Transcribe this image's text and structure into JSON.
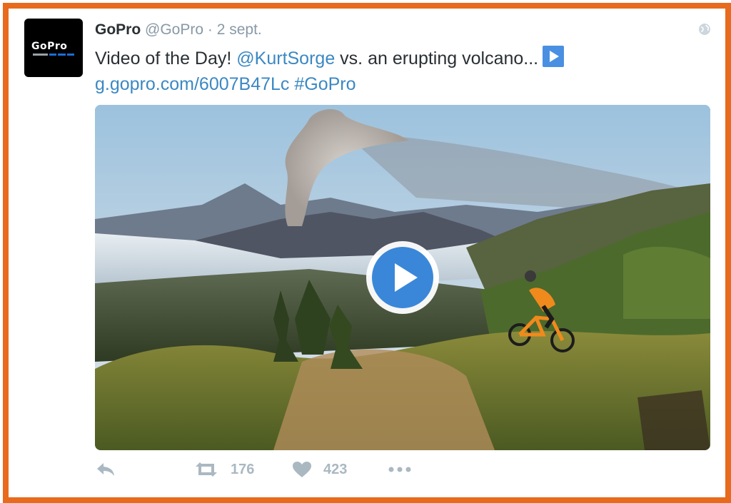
{
  "tweet": {
    "author_name": "GoPro",
    "handle": "@GoPro",
    "separator": " · ",
    "date": "2 sept.",
    "avatar_text": "GoPro",
    "text_prefix": "Video of the Day! ",
    "mention": "@KurtSorge",
    "text_middle": " vs. an erupting volcano...",
    "url": "g.gopro.com/6007B47Lc",
    "hashtag": "#GoPro"
  },
  "actions": {
    "retweets": "176",
    "likes": "423"
  },
  "colors": {
    "frame": "#e86a1c",
    "link": "#3b88c3",
    "play": "#3a87d9",
    "icon": "#aab8c2"
  },
  "icons": {
    "reply": "reply-icon",
    "retweet": "retweet-icon",
    "like": "heart-icon",
    "more": "more-icon",
    "globe": "globe-icon",
    "play": "play-icon"
  }
}
